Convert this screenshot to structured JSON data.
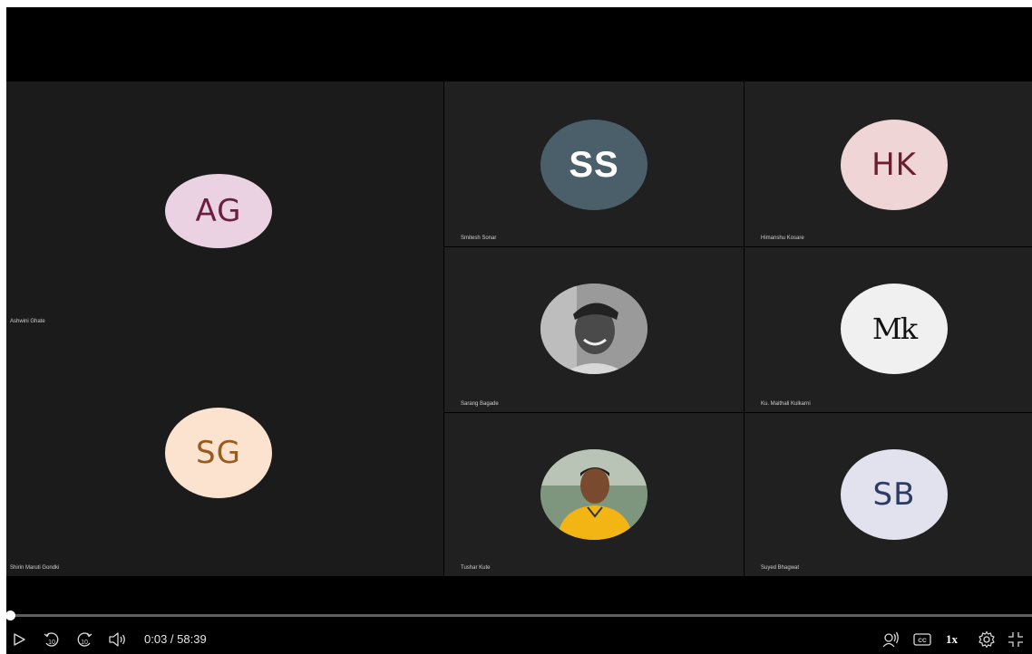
{
  "participants": [
    {
      "initials": "AG",
      "name": "Ashwini Ghate",
      "bg": "#ead2e2",
      "fg": "#6a1f3e"
    },
    {
      "initials": "SG",
      "name": "Shirin Maruti Gondki",
      "bg": "#fbe3cf",
      "fg": "#9a5a1c"
    },
    {
      "initials": "SS",
      "name": "Smitesh Sonar",
      "bg": "#4b5f6b",
      "fg": "#ffffff"
    },
    {
      "initials": "HK",
      "name": "Himanshu Kosare",
      "bg": "#f0d5d6",
      "fg": "#6b1f2e"
    },
    {
      "initials": "",
      "name": "Sarang Bagade",
      "bg": "#8a8a8a",
      "fg": "#ffffff"
    },
    {
      "initials": "Mk",
      "name": "Ku. Maithali Kulkarni",
      "bg": "#f0f0f0",
      "fg": "#111111"
    },
    {
      "initials": "",
      "name": "Tushar Kute",
      "bg": "#6f8a70",
      "fg": "#ffffff"
    },
    {
      "initials": "SB",
      "name": "Suyed Bhagwat",
      "bg": "#e2e2ee",
      "fg": "#2d3a63"
    }
  ],
  "player": {
    "time_display": "0:03 / 58:39",
    "progress_fraction": 0.0009,
    "speed_label": "1x",
    "controls": [
      "play-icon",
      "rewind-10-icon",
      "forward-10-icon",
      "volume-icon",
      "transcript-icon",
      "captions-icon",
      "settings-icon",
      "fullscreen-exit-icon"
    ],
    "captions_label": "CC",
    "skip_label": "10"
  }
}
